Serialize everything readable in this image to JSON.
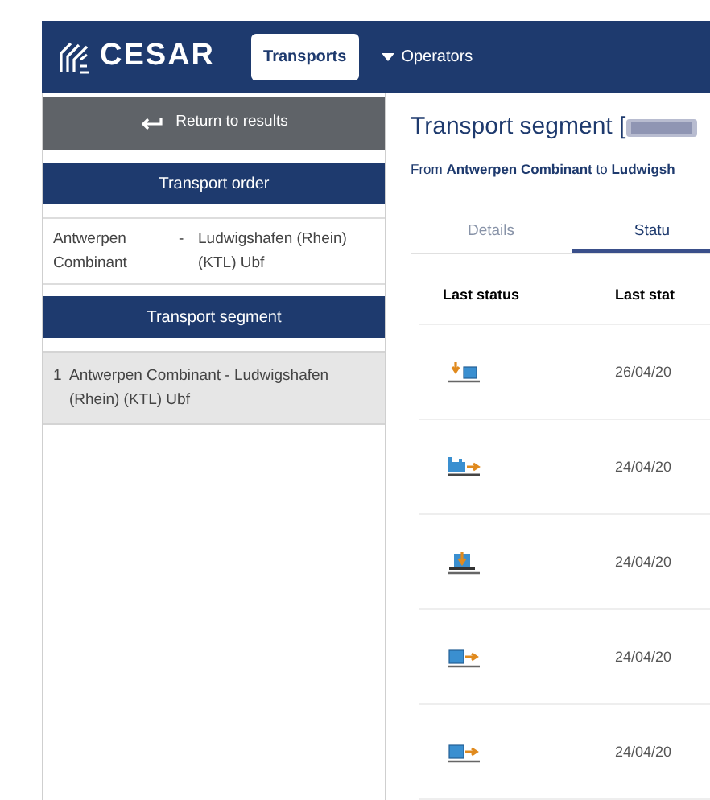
{
  "header": {
    "logo": "CESAR",
    "nav": [
      {
        "label": "Transports",
        "selected": true,
        "kind": "link"
      },
      {
        "label": "Operators",
        "selected": false,
        "kind": "dropdown"
      }
    ]
  },
  "sidebar": {
    "back": "Return to results",
    "order_heading": "Transport order",
    "order": {
      "from": "Antwerpen Combinant",
      "separator": "-",
      "to": "Ludwigshafen (Rhein) (KTL) Ubf"
    },
    "segment_heading": "Transport segment",
    "segments": [
      {
        "number": "1",
        "label": "Antwerpen Combinant - Ludwigshafen (Rhein) (KTL) Ubf",
        "selected": true
      }
    ]
  },
  "main": {
    "title": "Transport segment [",
    "route": {
      "from_word": "From",
      "from": "Antwerpen Combinant",
      "to_word": "to",
      "to": "Ludwigsh"
    },
    "tabs": [
      {
        "label": "Details",
        "selected": false
      },
      {
        "label": "Statu",
        "selected": true
      }
    ],
    "table": {
      "columns": [
        "Last status",
        "Last stat"
      ],
      "rows": [
        {
          "kind": "unload",
          "date": "26/04/20"
        },
        {
          "kind": "train_depart",
          "date": "24/04/20"
        },
        {
          "kind": "load_wagon",
          "date": "24/04/20"
        },
        {
          "kind": "depart",
          "date": "24/04/20"
        },
        {
          "kind": "depart",
          "date": "24/04/20"
        }
      ]
    }
  }
}
